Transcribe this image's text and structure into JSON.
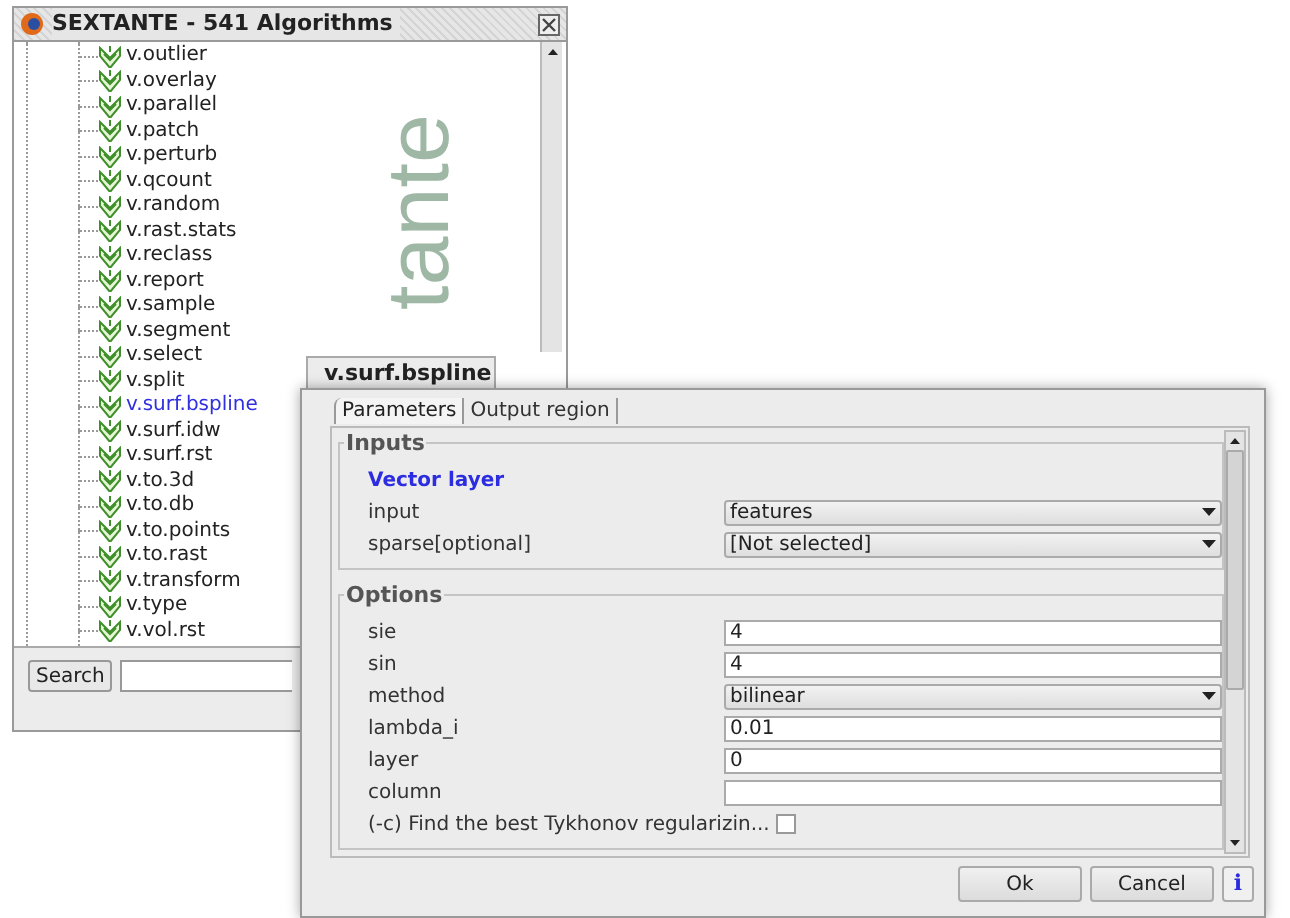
{
  "back_window": {
    "title": "SEXTANTE - 541 Algorithms",
    "logo_text": "tante",
    "tree_items": [
      {
        "label": "v.outlier",
        "selected": false
      },
      {
        "label": "v.overlay",
        "selected": false
      },
      {
        "label": "v.parallel",
        "selected": false
      },
      {
        "label": "v.patch",
        "selected": false
      },
      {
        "label": "v.perturb",
        "selected": false
      },
      {
        "label": "v.qcount",
        "selected": false
      },
      {
        "label": "v.random",
        "selected": false
      },
      {
        "label": "v.rast.stats",
        "selected": false
      },
      {
        "label": "v.reclass",
        "selected": false
      },
      {
        "label": "v.report",
        "selected": false
      },
      {
        "label": "v.sample",
        "selected": false
      },
      {
        "label": "v.segment",
        "selected": false
      },
      {
        "label": "v.select",
        "selected": false
      },
      {
        "label": "v.split",
        "selected": false
      },
      {
        "label": "v.surf.bspline",
        "selected": true
      },
      {
        "label": "v.surf.idw",
        "selected": false
      },
      {
        "label": "v.surf.rst",
        "selected": false
      },
      {
        "label": "v.to.3d",
        "selected": false
      },
      {
        "label": "v.to.db",
        "selected": false
      },
      {
        "label": "v.to.points",
        "selected": false
      },
      {
        "label": "v.to.rast",
        "selected": false
      },
      {
        "label": "v.transform",
        "selected": false
      },
      {
        "label": "v.type",
        "selected": false
      },
      {
        "label": "v.vol.rst",
        "selected": false
      }
    ],
    "search_button": "Search"
  },
  "dialog": {
    "title": "v.surf.bspline",
    "tabs": [
      {
        "label": "Parameters",
        "selected": true
      },
      {
        "label": "Output region",
        "selected": false
      }
    ],
    "groups": [
      {
        "title": "Inputs",
        "rows": [
          {
            "kind": "heading",
            "label": "Vector layer"
          },
          {
            "kind": "select",
            "label": "input",
            "value": "features"
          },
          {
            "kind": "select",
            "label": "sparse[optional]",
            "value": "[Not selected]"
          }
        ]
      },
      {
        "title": "Options",
        "rows": [
          {
            "kind": "text",
            "label": "sie",
            "value": "4"
          },
          {
            "kind": "text",
            "label": "sin",
            "value": "4"
          },
          {
            "kind": "select",
            "label": "method",
            "value": "bilinear"
          },
          {
            "kind": "text",
            "label": "lambda_i",
            "value": "0.01"
          },
          {
            "kind": "text",
            "label": "layer",
            "value": "0"
          },
          {
            "kind": "text",
            "label": "column"
          },
          {
            "kind": "checkbox",
            "label": "(-c) Find the best Tykhonov regularizin...",
            "checked": false
          }
        ]
      }
    ],
    "buttons": [
      "Ok",
      "Cancel"
    ],
    "info_button": "i"
  }
}
